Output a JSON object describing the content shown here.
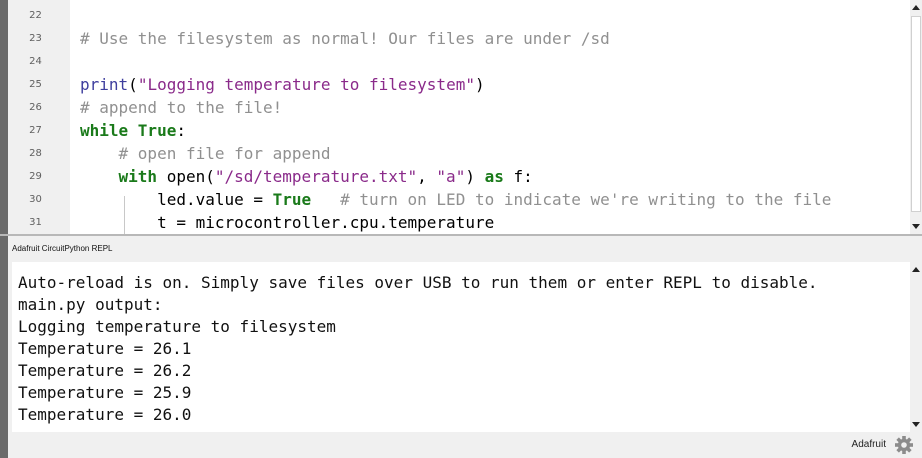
{
  "editor": {
    "lines": [
      {
        "num": "22",
        "parts": []
      },
      {
        "num": "23",
        "parts": [
          {
            "t": "# Use the filesystem as normal! Our files are under /sd",
            "c": "cm"
          }
        ]
      },
      {
        "num": "24",
        "parts": []
      },
      {
        "num": "25",
        "parts": [
          {
            "t": "print",
            "c": "fn"
          },
          {
            "t": "(",
            "c": ""
          },
          {
            "t": "\"Logging temperature to filesystem\"",
            "c": "st"
          },
          {
            "t": ")",
            "c": ""
          }
        ]
      },
      {
        "num": "26",
        "parts": [
          {
            "t": "# append to the file!",
            "c": "cm"
          }
        ]
      },
      {
        "num": "27",
        "parts": [
          {
            "t": "while True",
            "c": "kw"
          },
          {
            "t": ":",
            "c": ""
          }
        ]
      },
      {
        "num": "28",
        "parts": [
          {
            "t": "    ",
            "c": ""
          },
          {
            "t": "# open file for append",
            "c": "cm"
          }
        ]
      },
      {
        "num": "29",
        "parts": [
          {
            "t": "    ",
            "c": ""
          },
          {
            "t": "with",
            "c": "kw"
          },
          {
            "t": " open(",
            "c": ""
          },
          {
            "t": "\"/sd/temperature.txt\"",
            "c": "st"
          },
          {
            "t": ", ",
            "c": ""
          },
          {
            "t": "\"a\"",
            "c": "st"
          },
          {
            "t": ") ",
            "c": ""
          },
          {
            "t": "as",
            "c": "kw"
          },
          {
            "t": " f:",
            "c": ""
          }
        ]
      },
      {
        "num": "30",
        "parts": [
          {
            "t": "        led.value = ",
            "c": ""
          },
          {
            "t": "True",
            "c": "kw"
          },
          {
            "t": "   ",
            "c": ""
          },
          {
            "t": "# turn on LED to indicate we're writing to the file",
            "c": "cm"
          }
        ]
      },
      {
        "num": "31",
        "parts": [
          {
            "t": "        t = microcontroller.cpu.temperature",
            "c": ""
          }
        ]
      }
    ]
  },
  "repl": {
    "title": "Adafruit CircuitPython REPL",
    "lines": [
      "Auto-reload is on. Simply save files over USB to run them or enter REPL to disable.",
      "main.py output:",
      "Logging temperature to filesystem",
      "Temperature = 26.1",
      "Temperature = 26.2",
      "Temperature = 25.9",
      "Temperature = 26.0"
    ]
  },
  "status": {
    "label": "Adafruit",
    "icon": "gear-icon"
  }
}
